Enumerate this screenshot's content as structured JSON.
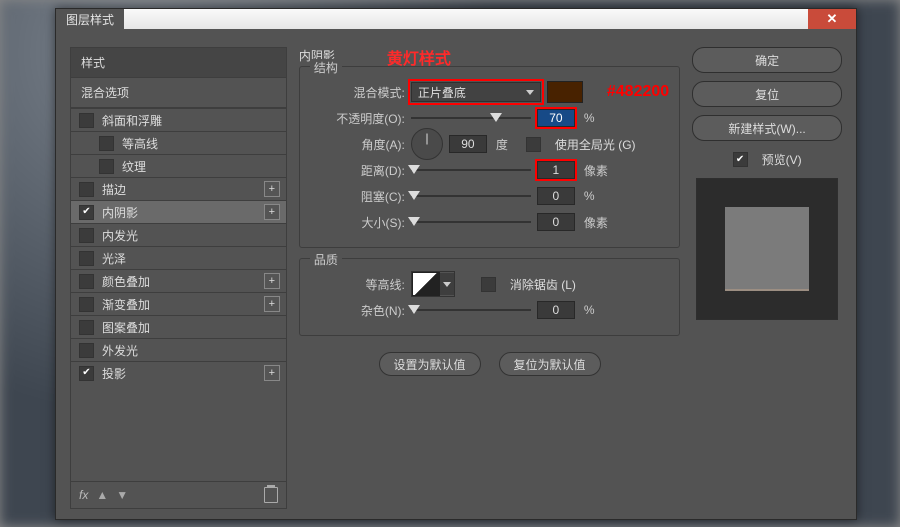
{
  "window": {
    "title": "图层样式",
    "close_glyph": "✕"
  },
  "annotations": {
    "title": "黄灯样式",
    "swatch_hex": "#482200"
  },
  "left": {
    "header": "样式",
    "subheader": "混合选项",
    "items": [
      {
        "label": "斜面和浮雕",
        "checked": false,
        "plus": false
      },
      {
        "label": "等高线",
        "checked": false,
        "plus": false,
        "child": true
      },
      {
        "label": "纹理",
        "checked": false,
        "plus": false,
        "child": true
      },
      {
        "label": "描边",
        "checked": false,
        "plus": true
      },
      {
        "label": "内阴影",
        "checked": true,
        "plus": true,
        "active": true
      },
      {
        "label": "内发光",
        "checked": false,
        "plus": false
      },
      {
        "label": "光泽",
        "checked": false,
        "plus": false
      },
      {
        "label": "颜色叠加",
        "checked": false,
        "plus": true
      },
      {
        "label": "渐变叠加",
        "checked": false,
        "plus": true
      },
      {
        "label": "图案叠加",
        "checked": false,
        "plus": false
      },
      {
        "label": "外发光",
        "checked": false,
        "plus": false
      },
      {
        "label": "投影",
        "checked": true,
        "plus": true
      }
    ],
    "footer_fx": "fx"
  },
  "mid": {
    "panel_title": "内阴影",
    "structure": {
      "legend": "结构",
      "blend_mode_label": "混合模式:",
      "blend_mode_value": "正片叠底",
      "opacity_label": "不透明度(O):",
      "opacity_value": "70",
      "opacity_unit": "%",
      "angle_label": "角度(A):",
      "angle_value": "90",
      "angle_unit": "度",
      "global_light_label": "使用全局光 (G)",
      "distance_label": "距离(D):",
      "distance_value": "1",
      "distance_unit": "像素",
      "choke_label": "阻塞(C):",
      "choke_value": "0",
      "choke_unit": "%",
      "size_label": "大小(S):",
      "size_value": "0",
      "size_unit": "像素"
    },
    "quality": {
      "legend": "品质",
      "contour_label": "等高线:",
      "antialias_label": "消除锯齿 (L)",
      "noise_label": "杂色(N):",
      "noise_value": "0",
      "noise_unit": "%"
    },
    "buttons": {
      "make_default": "设置为默认值",
      "reset_default": "复位为默认值"
    }
  },
  "right": {
    "ok": "确定",
    "reset": "复位",
    "new_style": "新建样式(W)...",
    "preview_label": "预览(V)"
  }
}
